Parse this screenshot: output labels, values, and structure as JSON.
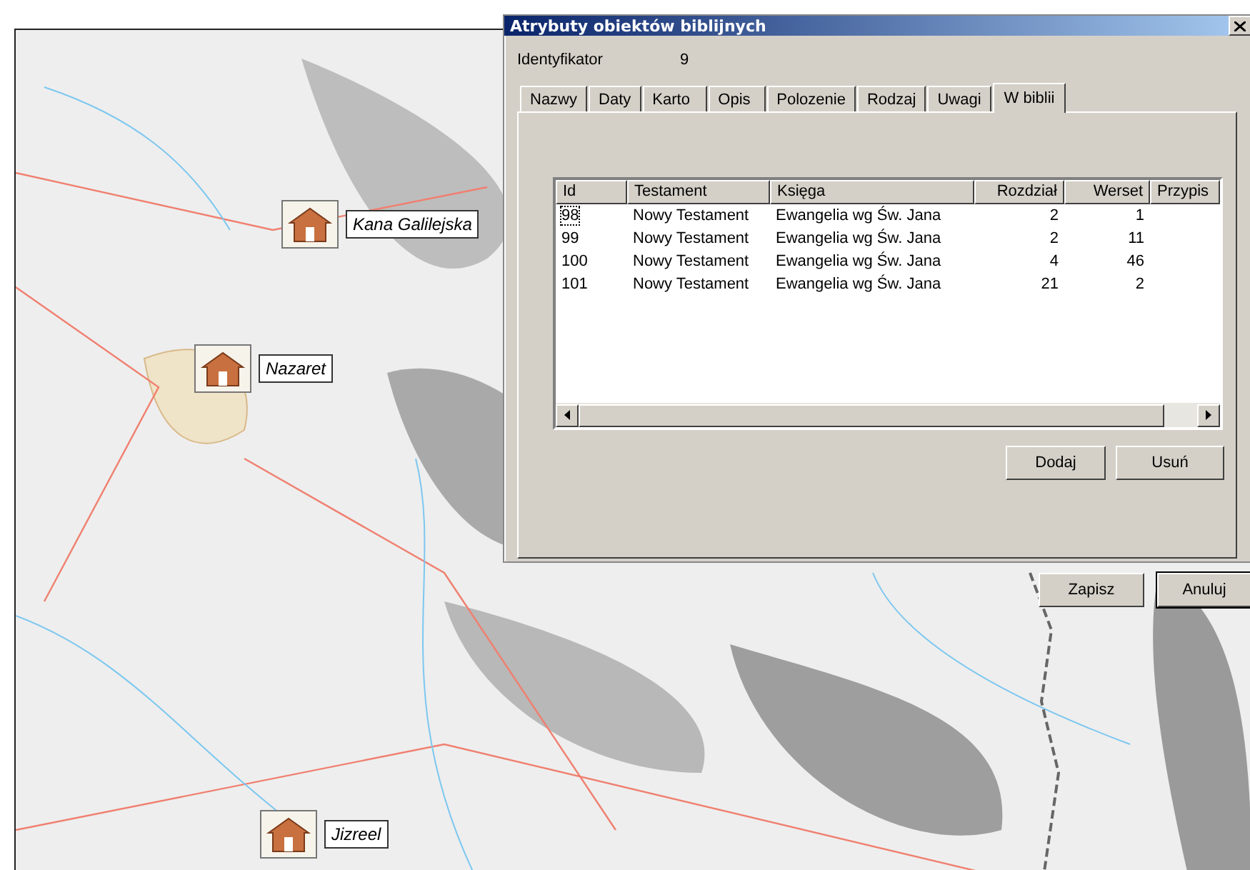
{
  "map": {
    "markers": [
      {
        "label": "Kana Galilejska"
      },
      {
        "label": "Nazaret"
      },
      {
        "label": "Jizreel"
      }
    ]
  },
  "dialog": {
    "title": "Atrybuty obiektów biblijnych",
    "identifier": {
      "label": "Identyfikator",
      "value": "9"
    },
    "tabs": [
      {
        "label": "Nazwy",
        "selected": false
      },
      {
        "label": "Daty",
        "selected": false
      },
      {
        "label": "Karto",
        "selected": false
      },
      {
        "label": "Opis",
        "selected": false
      },
      {
        "label": "Polozenie",
        "selected": false
      },
      {
        "label": "Rodzaj",
        "selected": false
      },
      {
        "label": "Uwagi",
        "selected": false
      },
      {
        "label": "W biblii",
        "selected": true
      }
    ],
    "table": {
      "columns": [
        {
          "label": "Id"
        },
        {
          "label": "Testament"
        },
        {
          "label": "Księga"
        },
        {
          "label": "Rozdział"
        },
        {
          "label": "Werset"
        },
        {
          "label": "Przypis"
        }
      ],
      "rows": [
        {
          "focused": true,
          "cells": [
            "98",
            "Nowy Testament",
            "Ewangelia wg Św. Jana",
            "2",
            "1"
          ]
        },
        {
          "focused": false,
          "cells": [
            "99",
            "Nowy Testament",
            "Ewangelia wg Św. Jana",
            "2",
            "11"
          ]
        },
        {
          "focused": false,
          "cells": [
            "100",
            "Nowy Testament",
            "Ewangelia wg Św. Jana",
            "4",
            "46"
          ]
        },
        {
          "focused": false,
          "cells": [
            "101",
            "Nowy Testament",
            "Ewangelia wg Św. Jana",
            "21",
            "2"
          ]
        }
      ]
    },
    "panel_buttons": [
      "Dodaj",
      "Usuń"
    ],
    "buttons": [
      {
        "label": "Zapisz",
        "default": false
      },
      {
        "label": "Anuluj",
        "default": true
      }
    ]
  }
}
